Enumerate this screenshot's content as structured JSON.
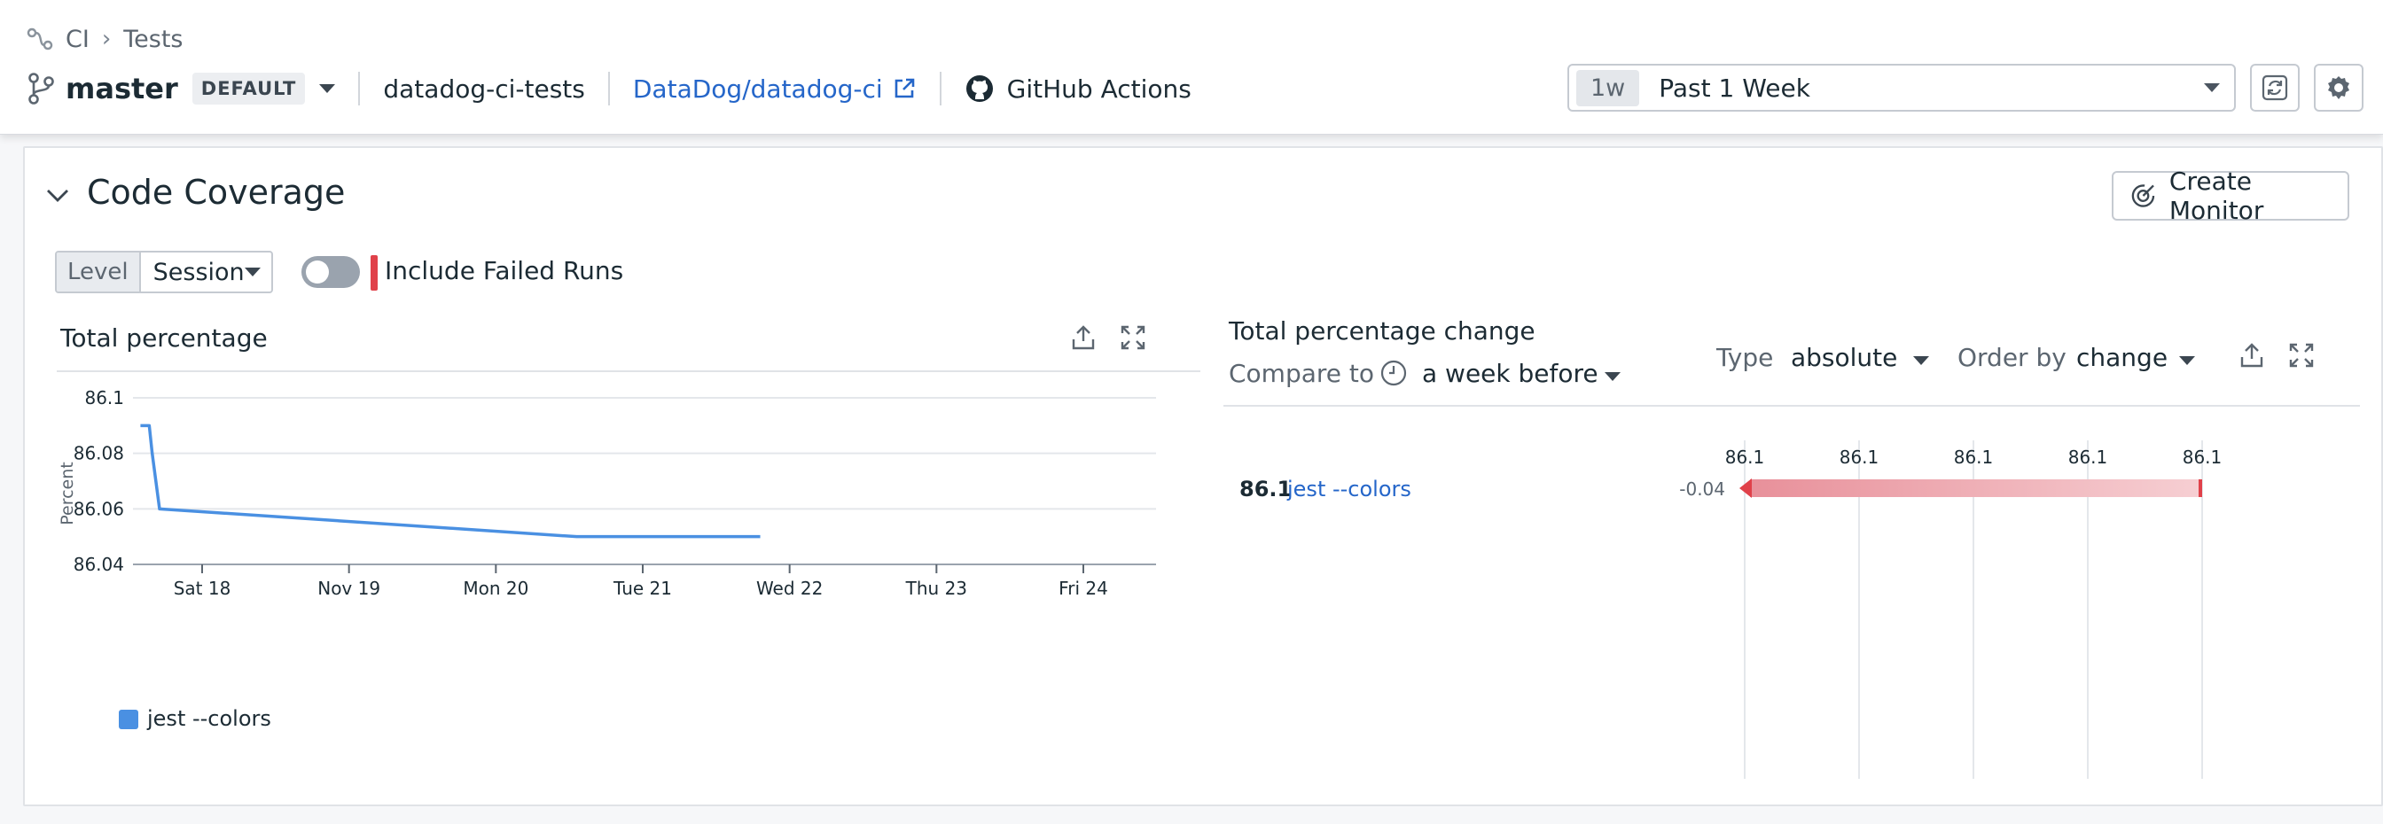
{
  "breadcrumb": {
    "root": "CI",
    "current": "Tests"
  },
  "branch": {
    "name": "master",
    "badge": "DEFAULT",
    "service": "datadog-ci-tests",
    "repo": "DataDog/datadog-ci",
    "provider": "GitHub Actions"
  },
  "time": {
    "chip": "1w",
    "label": "Past 1 Week"
  },
  "section": {
    "title": "Code Coverage",
    "create_monitor": "Create Monitor",
    "level_label": "Level",
    "level_value": "Session",
    "include_failed_label": "Include Failed Runs",
    "include_failed_enabled": false
  },
  "total_percentage": {
    "title": "Total percentage",
    "chart_data": {
      "type": "line",
      "ylabel": "Percent",
      "ylim": [
        86.04,
        86.1
      ],
      "yticks": [
        "86.1",
        "86.08",
        "86.06",
        "86.04"
      ],
      "xticks": [
        "Sat 18",
        "Nov 19",
        "Mon 20",
        "Tue 21",
        "Wed 22",
        "Thu 23",
        "Fri 24"
      ],
      "x_range_days": [
        0,
        7
      ],
      "series": [
        {
          "name": "jest --colors",
          "color": "#4a90e2",
          "x": [
            -0.42,
            -0.36,
            -0.34,
            -0.29,
            2.55,
            3.8
          ],
          "y": [
            86.09,
            86.09,
            86.08,
            86.06,
            86.05,
            86.05
          ]
        }
      ]
    }
  },
  "percentage_change": {
    "title": "Total percentage change",
    "compare_label": "Compare to",
    "compare_value": "a week before",
    "type_label": "Type",
    "type_value": "absolute",
    "order_label": "Order by",
    "order_value": "change",
    "chart_data": {
      "type": "bar",
      "orientation": "horizontal",
      "axis_ticks": [
        "86.1",
        "86.1",
        "86.1",
        "86.1",
        "86.1"
      ],
      "rows": [
        {
          "value": "86.1",
          "name": "jest --colors",
          "change": "-0.04",
          "color": "#e0414a"
        }
      ]
    }
  }
}
